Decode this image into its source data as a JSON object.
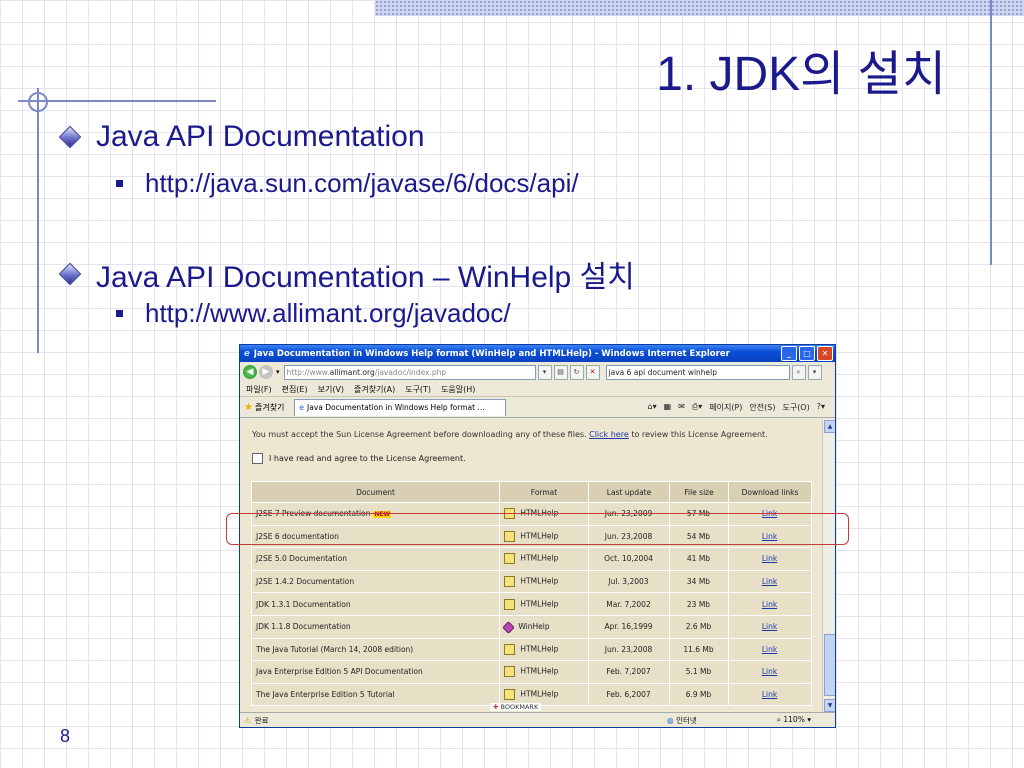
{
  "slide": {
    "title": "1. JDK의 설치",
    "page_number": "8",
    "bullets": [
      {
        "text": "Java API Documentation",
        "sub": "http://java.sun.com/javase/6/docs/api/"
      },
      {
        "text": "Java API Documentation – WinHelp 설치",
        "sub": "http://www.allimant.org/javadoc/"
      }
    ]
  },
  "browser": {
    "window_title": "Java Documentation in Windows Help format (WinHelp and HTMLHelp) - Windows Internet Explorer",
    "address_prefix": "http://www.",
    "address_host": "allimant.org",
    "address_path": "/javadoc/index.php",
    "search_value": "java 6 api document winhelp",
    "menu": [
      "파일(F)",
      "편집(E)",
      "보기(V)",
      "즐겨찾기(A)",
      "도구(T)",
      "도움말(H)"
    ],
    "favorites_label": "즐겨찾기",
    "tab_title": "Java Documentation in Windows Help format ...",
    "tools": {
      "page": "페이지(P)",
      "safety": "안전(S)",
      "tools": "도구(O)"
    },
    "license_text": "You must accept the Sun License Agreement before downloading any of these files.",
    "license_link": "Click here",
    "license_text_after": "to review this License Agreement.",
    "agree_label": "I have read and agree to the License Agreement.",
    "table": {
      "headers": [
        "Document",
        "Format",
        "Last update",
        "File size",
        "Download links"
      ],
      "rows": [
        {
          "doc": "J2SE 7 Preview documentation",
          "new": "NEW",
          "format": "HTMLHelp",
          "fmt_icon": "htmlhelp-icon",
          "date": "Jun. 23,2009",
          "size": "57 Mb",
          "link": "Link"
        },
        {
          "doc": "J2SE 6 documentation",
          "new": "",
          "format": "HTMLHelp",
          "fmt_icon": "htmlhelp-icon",
          "date": "Jun. 23,2008",
          "size": "54 Mb",
          "link": "Link"
        },
        {
          "doc": "J2SE 5.0 Documentation",
          "new": "",
          "format": "HTMLHelp",
          "fmt_icon": "htmlhelp-icon",
          "date": "Oct. 10,2004",
          "size": "41 Mb",
          "link": "Link"
        },
        {
          "doc": "J2SE 1.4.2 Documentation",
          "new": "",
          "format": "HTMLHelp",
          "fmt_icon": "htmlhelp-icon",
          "date": "Jul. 3,2003",
          "size": "34 Mb",
          "link": "Link"
        },
        {
          "doc": "JDK 1.3.1 Documentation",
          "new": "",
          "format": "HTMLHelp",
          "fmt_icon": "htmlhelp-icon",
          "date": "Mar. 7,2002",
          "size": "23 Mb",
          "link": "Link"
        },
        {
          "doc": "JDK 1.1.8 Documentation",
          "new": "",
          "format": "WinHelp",
          "fmt_icon": "winhelp-icon",
          "date": "Apr. 16,1999",
          "size": "2.6 Mb",
          "link": "Link"
        },
        {
          "doc": "The Java Tutorial (March 14, 2008 edition)",
          "new": "",
          "format": "HTMLHelp",
          "fmt_icon": "htmlhelp-icon",
          "date": "Jun. 23,2008",
          "size": "11.6 Mb",
          "link": "Link"
        },
        {
          "doc": "Java Enterprise Edition 5 API Documentation",
          "new": "",
          "format": "HTMLHelp",
          "fmt_icon": "htmlhelp-icon",
          "date": "Feb. 7,2007",
          "size": "5.1 Mb",
          "link": "Link"
        },
        {
          "doc": "The Java Enterprise Edition 5 Tutorial",
          "new": "",
          "format": "HTMLHelp",
          "fmt_icon": "htmlhelp-icon",
          "date": "Feb. 6,2007",
          "size": "6.9 Mb",
          "link": "Link"
        }
      ]
    },
    "bookmark_label": "BOOKMARK",
    "status_left": "완료",
    "status_zone": "인터넷",
    "zoom": "110%"
  },
  "colors": {
    "accent": "#1a1a8c",
    "highlight": "#c83a3a",
    "titlebar": "#0a4fd6"
  }
}
